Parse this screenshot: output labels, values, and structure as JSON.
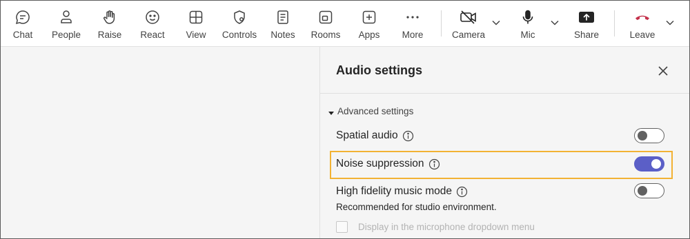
{
  "toolbar": {
    "items": [
      {
        "label": "Chat",
        "icon": "chat-icon"
      },
      {
        "label": "People",
        "icon": "people-icon"
      },
      {
        "label": "Raise",
        "icon": "raise-hand-icon"
      },
      {
        "label": "React",
        "icon": "react-smiley-icon"
      },
      {
        "label": "View",
        "icon": "view-grid-icon"
      },
      {
        "label": "Controls",
        "icon": "controls-shield-icon"
      },
      {
        "label": "Notes",
        "icon": "notes-icon"
      },
      {
        "label": "Rooms",
        "icon": "rooms-icon"
      },
      {
        "label": "Apps",
        "icon": "apps-plus-icon"
      },
      {
        "label": "More",
        "icon": "more-ellipsis-icon"
      }
    ],
    "camera_label": "Camera",
    "mic_label": "Mic",
    "share_label": "Share",
    "leave_label": "Leave",
    "leave_color": "#c4314b"
  },
  "panel": {
    "title": "Audio settings",
    "section_label": "Advanced settings",
    "settings": [
      {
        "label": "Spatial audio",
        "enabled": false
      },
      {
        "label": "Noise suppression",
        "enabled": true,
        "highlighted": true
      },
      {
        "label": "High fidelity music mode",
        "enabled": false
      }
    ],
    "helper_text": "Recommended for studio environment.",
    "checkbox_label": "Display in the microphone dropdown menu",
    "checkbox_checked": false,
    "checkbox_disabled": true
  },
  "colors": {
    "accent": "#5b5fc7",
    "highlight": "#f2b233"
  }
}
